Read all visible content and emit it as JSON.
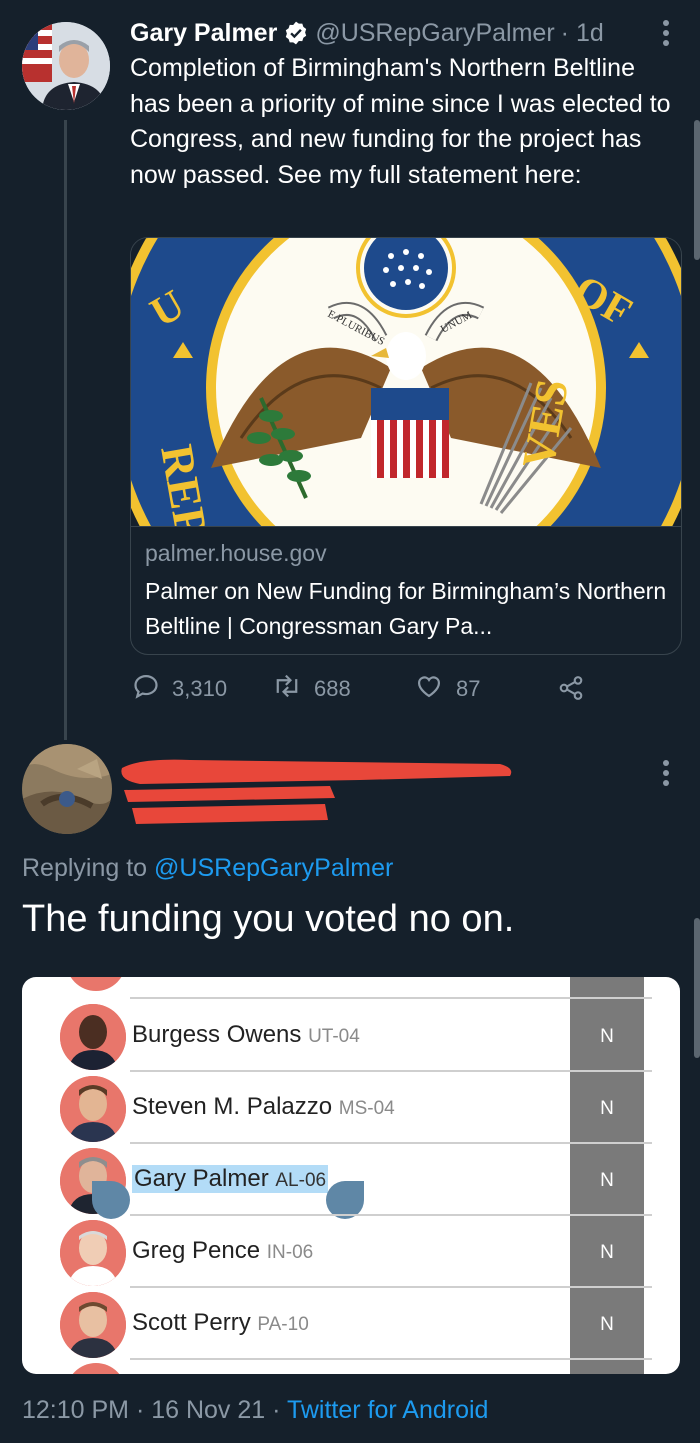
{
  "tweet": {
    "author_name": "Gary Palmer",
    "handle": "@USRepGaryPalmer",
    "time": "· 1d",
    "text": "Completion of Birmingham's Northern Beltline has been a priority of mine since I was elected to Congress, and new funding for the project has now passed. See my full statement here:",
    "card": {
      "domain": "palmer.house.gov",
      "title": "Palmer on New Funding for Birmingham’s Northern Beltline | Congressman Gary Pa...",
      "seal_text": "U OF REP VES",
      "seal_banner_left": "E PLURIBUS",
      "seal_banner_right": "UNUM"
    },
    "stats": {
      "replies": "3,310",
      "retweets": "688",
      "likes": "87"
    }
  },
  "reply": {
    "replying_prefix": "Replying to",
    "replying_handle": "@USRepGaryPalmer",
    "text": "The funding you voted no on.",
    "vote_table": [
      {
        "name": "Burgess Owens",
        "district": "UT-04",
        "vote": "N"
      },
      {
        "name": "Steven M. Palazzo",
        "district": "MS-04",
        "vote": "N"
      },
      {
        "name": "Gary Palmer",
        "district": "AL-06",
        "vote": "N",
        "highlighted": true
      },
      {
        "name": "Greg Pence",
        "district": "IN-06",
        "vote": "N"
      },
      {
        "name": "Scott Perry",
        "district": "PA-10",
        "vote": "N"
      }
    ],
    "timestamp": "12:10 PM · 16 Nov 21 · ",
    "source": "Twitter for Android"
  },
  "colors": {
    "background": "#15202b",
    "link": "#1d9bf0",
    "muted": "#8b98a5",
    "verified": "#ffffff",
    "redaction": "#e8473a",
    "highlight": "#b3dcf7"
  },
  "icons": [
    "verified-badge-icon",
    "more-options-icon",
    "reply-icon",
    "retweet-icon",
    "like-icon",
    "share-icon"
  ]
}
